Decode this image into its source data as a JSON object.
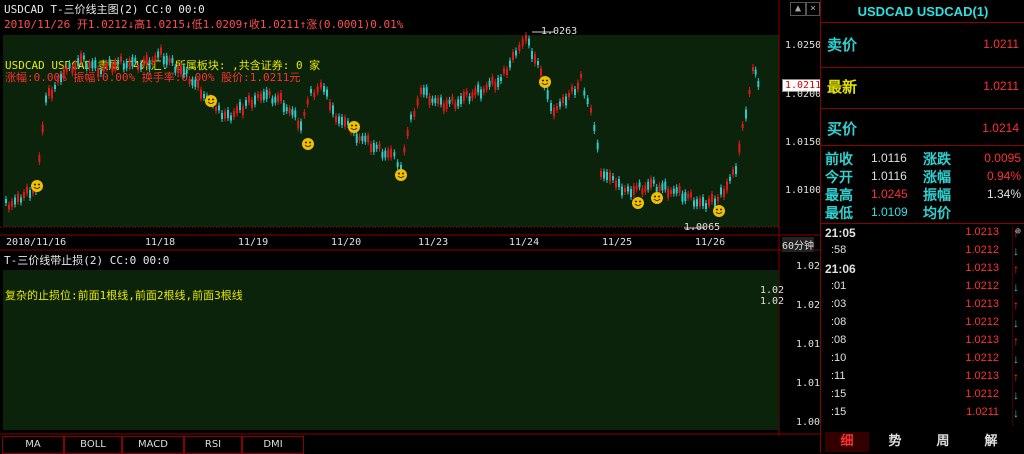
{
  "main": {
    "title": "USDCAD T-三价线主图(2) CC:0 00:0",
    "ohlc": "2010/11/26 开1.0212↓高1.0215↓低1.0209↑收1.0211↑涨(0.0001)0.01%",
    "info1": "USDCAD USDCAD 隶属 T4外汇. 所属板块: ,共含证券: 0 家",
    "info2": "涨幅:0.00% 振幅:0.00% 换手率:0.00% 股价:1.0211元",
    "high_label": "1.0263",
    "low_label": "1.0065",
    "current_price_tag": "1.0211",
    "y_ticks": [
      "1.0250",
      "1.0200",
      "1.0150",
      "1.0100"
    ],
    "date_labels": [
      "2010/11/16",
      "11/18",
      "11/19",
      "11/20",
      "11/23",
      "11/24",
      "11/25",
      "11/26"
    ],
    "period": "60分钟"
  },
  "sub": {
    "title": "T-三价线带止损(2) CC:0 00:0",
    "note": "复杂的止损位:前面1根线,前面2根线,前面3根线",
    "y_ticks": [
      "1.02",
      "1.02",
      "1.01",
      "1.01",
      "1.00"
    ],
    "right_marks": [
      "1.02",
      "1.02"
    ]
  },
  "tabs": [
    "MA",
    "BOLL",
    "MACD",
    "RSI",
    "DMI"
  ],
  "panel": {
    "title": "USDCAD USDCAD(1)",
    "sell_label": "卖价",
    "sell_value": "1.0211",
    "last_label": "最新",
    "last_value": "1.0211",
    "buy_label": "买价",
    "buy_value": "1.0214",
    "stats": [
      {
        "l1": "前收",
        "v1": "1.0116",
        "l2": "涨跌",
        "v2": "0.0095"
      },
      {
        "l1": "今开",
        "v1": "1.0116",
        "l2": "涨幅",
        "v2": "0.94%"
      },
      {
        "l1": "最高",
        "v1": "1.0245",
        "l2": "振幅",
        "v2": "1.34%"
      },
      {
        "l1": "最低",
        "v1": "1.0109",
        "l2": "均价",
        "v2": ""
      }
    ],
    "ticks": [
      {
        "t": "21:05",
        "p": "1.0213",
        "dir": "up"
      },
      {
        "t": ":58",
        "p": "1.0212",
        "dir": "down"
      },
      {
        "t": "21:06",
        "p": "1.0213",
        "dir": "up"
      },
      {
        "t": ":01",
        "p": "1.0212",
        "dir": "down"
      },
      {
        "t": ":03",
        "p": "1.0213",
        "dir": "up"
      },
      {
        "t": ":08",
        "p": "1.0212",
        "dir": "down"
      },
      {
        "t": ":08",
        "p": "1.0213",
        "dir": "up"
      },
      {
        "t": ":10",
        "p": "1.0212",
        "dir": "down"
      },
      {
        "t": ":11",
        "p": "1.0213",
        "dir": "up"
      },
      {
        "t": ":15",
        "p": "1.0212",
        "dir": "down"
      },
      {
        "t": ":15",
        "p": "1.0211",
        "dir": "down"
      }
    ],
    "bottom_tabs": [
      "细",
      "势",
      "周",
      "解"
    ]
  },
  "colors": {
    "up": "#ff2020",
    "down": "#30d0d0",
    "grid": "#8a0000",
    "plot_bg": "#0a230a"
  }
}
